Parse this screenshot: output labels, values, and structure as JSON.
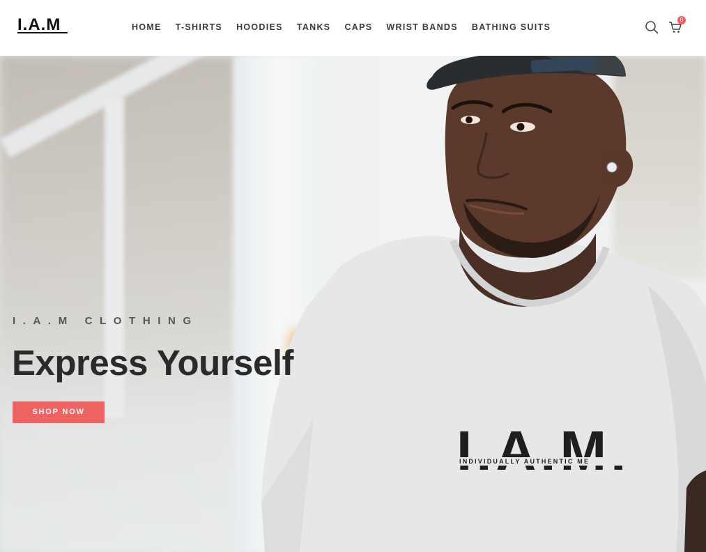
{
  "header": {
    "logo_text": "I.A.M",
    "logo_sub": "INDIVIDUALLY AUTHENTIC ME",
    "nav": [
      "HOME",
      "T-SHIRTS",
      "HOODIES",
      "TANKS",
      "CAPS",
      "WRIST BANDS",
      "BATHING SUITS"
    ],
    "cart_count": "0",
    "icons": [
      "search-icon",
      "cart-icon"
    ]
  },
  "hero": {
    "kicker": "I.A.M CLOTHING",
    "title": "Express Yourself",
    "cta": "SHOP NOW",
    "shirt_logo": "I.A.M.",
    "shirt_tagline": "INDIVIDUALLY AUTHENTIC ME"
  },
  "colors": {
    "accent": "#f06363",
    "badge": "#f15f5f",
    "nav_text": "#3a3a3a",
    "title_text": "#2a2a2a"
  }
}
